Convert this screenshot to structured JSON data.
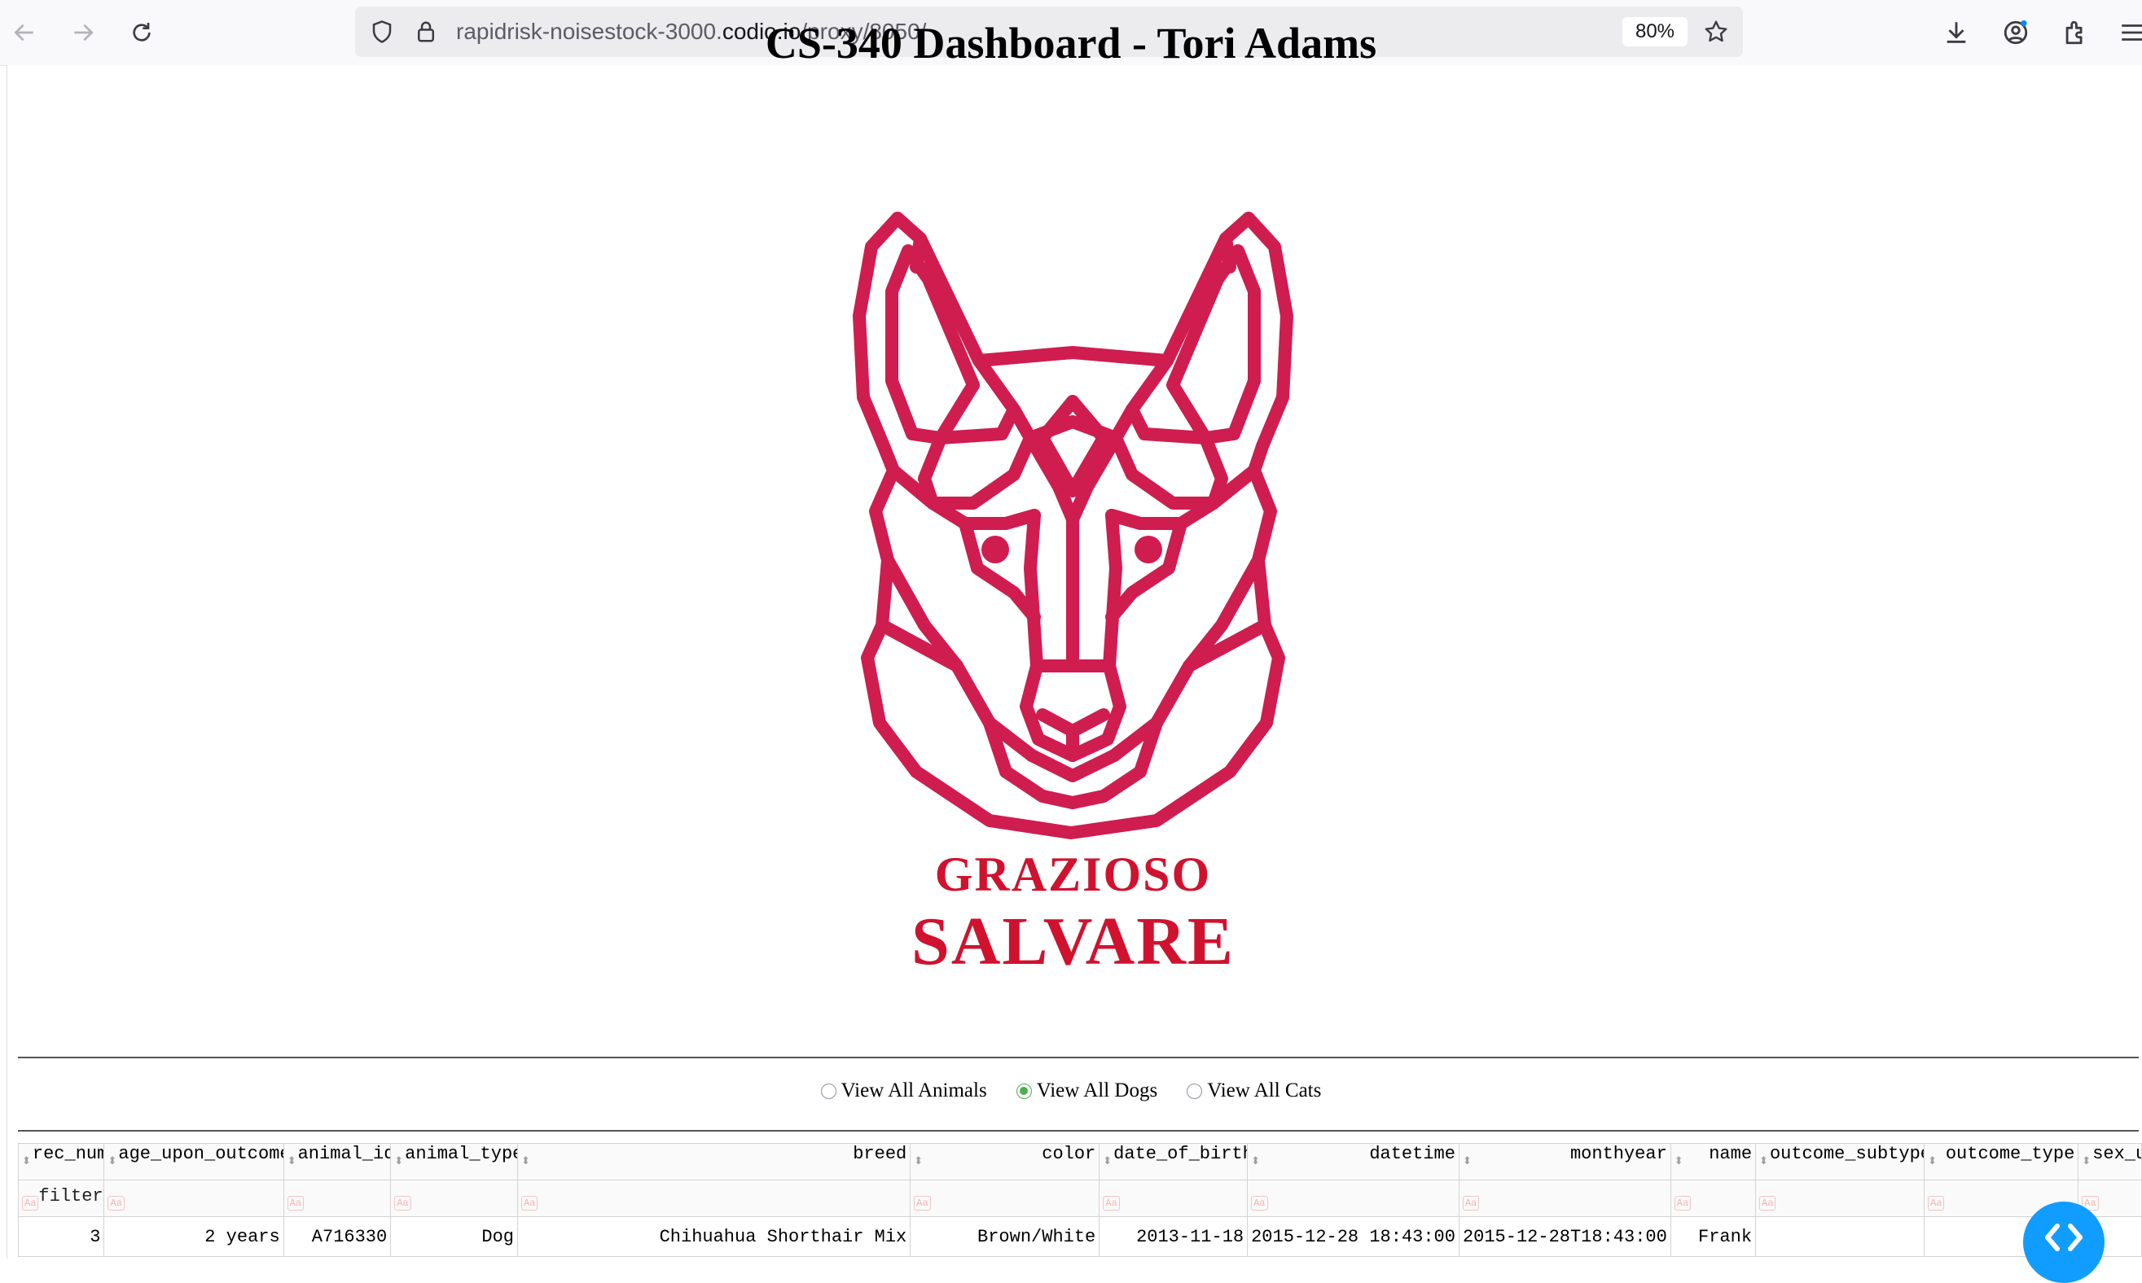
{
  "browser": {
    "url_prefix": "rapidrisk-noisestock-3000.",
    "url_domain": "codio.io",
    "url_suffix": "/proxy/8050/",
    "zoom": "80%"
  },
  "page": {
    "title": "CS-340 Dashboard - Tori Adams"
  },
  "logo": {
    "line1": "GRAZIOSO",
    "line2": "SALVARE",
    "color": "#cf1d4f",
    "text_color": "#d0122f"
  },
  "filter_options": [
    {
      "label": "View All Animals",
      "checked": false
    },
    {
      "label": "View All Dogs",
      "checked": true
    },
    {
      "label": "View All Cats",
      "checked": false
    }
  ],
  "table": {
    "columns": [
      "rec_num",
      "age_upon_outcome",
      "animal_id",
      "animal_type",
      "breed",
      "color",
      "date_of_birth",
      "datetime",
      "monthyear",
      "name",
      "outcome_subtype",
      "outcome_type",
      "sex_u"
    ],
    "filter_placeholder": "filter",
    "rows": [
      [
        "3",
        "2 years",
        "A716330",
        "Dog",
        "Chihuahua Shorthair Mix",
        "Brown/White",
        "2013-11-18",
        "2015-12-28 18:43:00",
        "2015-12-28T18:43:00",
        "Frank",
        "",
        "Ado",
        "Ne"
      ]
    ]
  },
  "icons": [
    "back-arrow-icon",
    "forward-arrow-icon",
    "reload-icon",
    "shield-icon",
    "lock-icon",
    "star-icon",
    "download-icon",
    "account-icon",
    "extensions-icon",
    "menu-icon",
    "debug-toggle-icon"
  ]
}
